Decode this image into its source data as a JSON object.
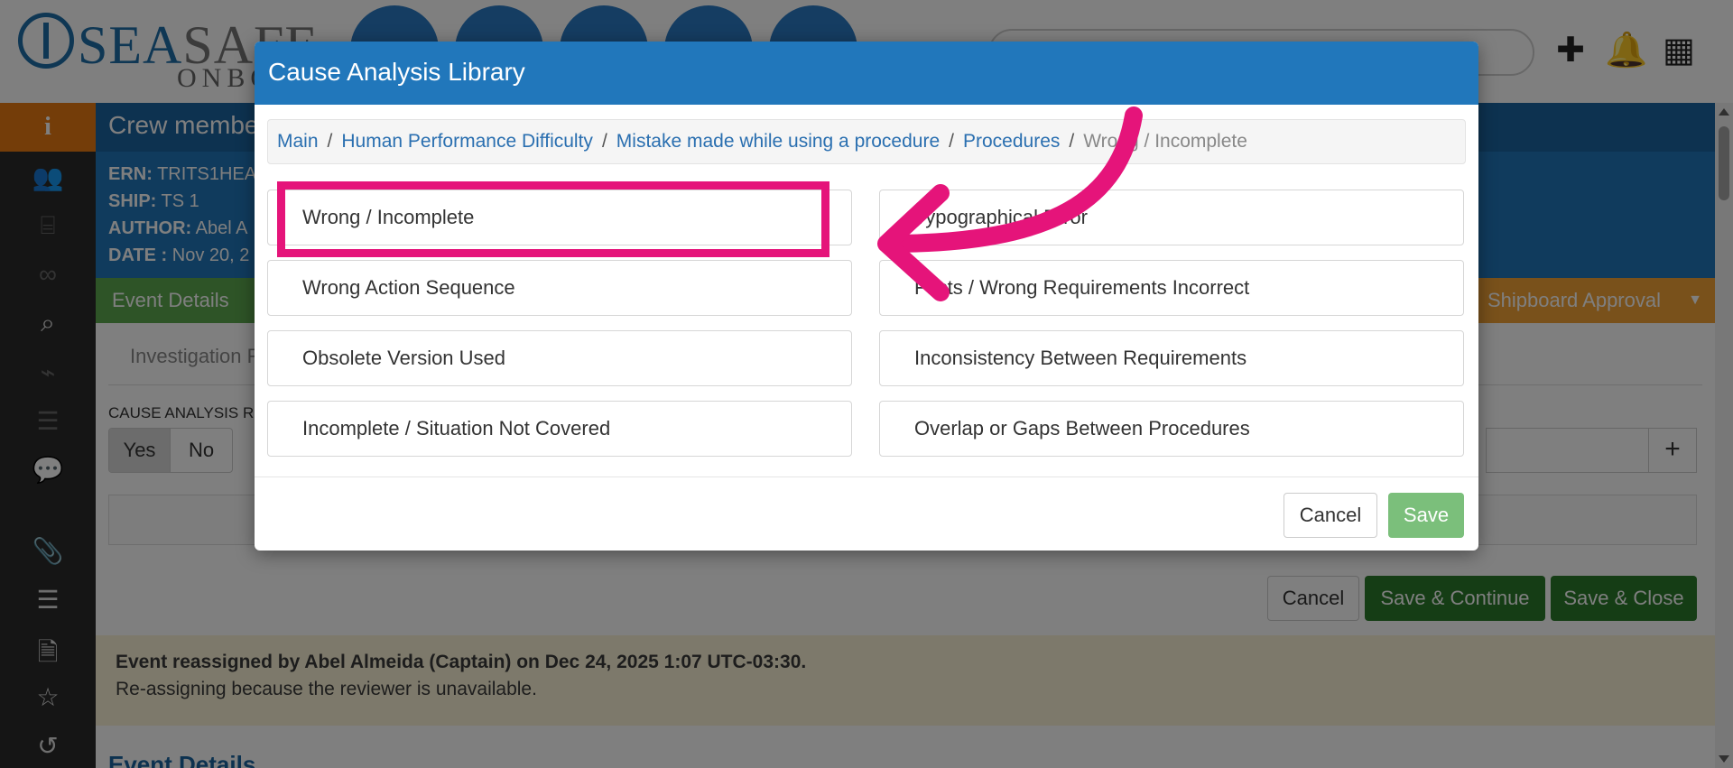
{
  "app": {
    "logo": {
      "primary": "SEA",
      "secondary": "SAFE",
      "sub": "ONBO"
    },
    "colors": {
      "accent": "#2177bb",
      "highlight": "#e5147a",
      "success": "#2a7a2a",
      "warning": "#f2a237"
    }
  },
  "topbar": {
    "icons": [
      "plus-icon",
      "bell-icon",
      "grid-icon"
    ],
    "glyphs": {
      "plus": "✚",
      "bell": "🔔",
      "grid": "▦"
    }
  },
  "background": {
    "header_title": "Crew membe",
    "info": {
      "ern_label": "ERN:",
      "ern_value": "TRITS1HEA",
      "ship_label": "SHIP:",
      "ship_value": "TS 1",
      "author_label": "AUTHOR:",
      "author_value": "Abel A",
      "date_label": "DATE :",
      "date_value": "Nov 20, 2"
    },
    "tabs": {
      "event_details": "Event Details",
      "shipboard_approval": "Shipboard Approval"
    },
    "subtab": "Investigation R",
    "cause_label": "CAUSE ANALYSIS RE",
    "yes": "Yes",
    "no": "No",
    "plus": "+",
    "buttons": {
      "cancel": "Cancel",
      "save_continue": "Save & Continue",
      "save_close": "Save & Close"
    },
    "notice": {
      "line1": "Event reassigned by Abel Almeida (Captain) on Dec 24, 2025 1:07 UTC-03:30.",
      "line2": "Re-assigning because the reviewer is unavailable."
    },
    "section_title": "Event Details"
  },
  "modal": {
    "title": "Cause Analysis Library",
    "breadcrumb": {
      "main": "Main",
      "hpd": "Human Performance Difficulty",
      "mistake": "Mistake made while using a procedure",
      "procedures": "Procedures",
      "current": "Wrong / Incomplete"
    },
    "options": {
      "left": [
        "Wrong / Incomplete",
        "Wrong Action Sequence",
        "Obsolete Version Used",
        "Incomplete / Situation Not Covered"
      ],
      "right": [
        "Typographical Error",
        "Facts / Wrong Requirements Incorrect",
        "Inconsistency Between Requirements",
        "Overlap or Gaps Between Procedures"
      ]
    },
    "buttons": {
      "cancel": "Cancel",
      "save": "Save"
    }
  }
}
